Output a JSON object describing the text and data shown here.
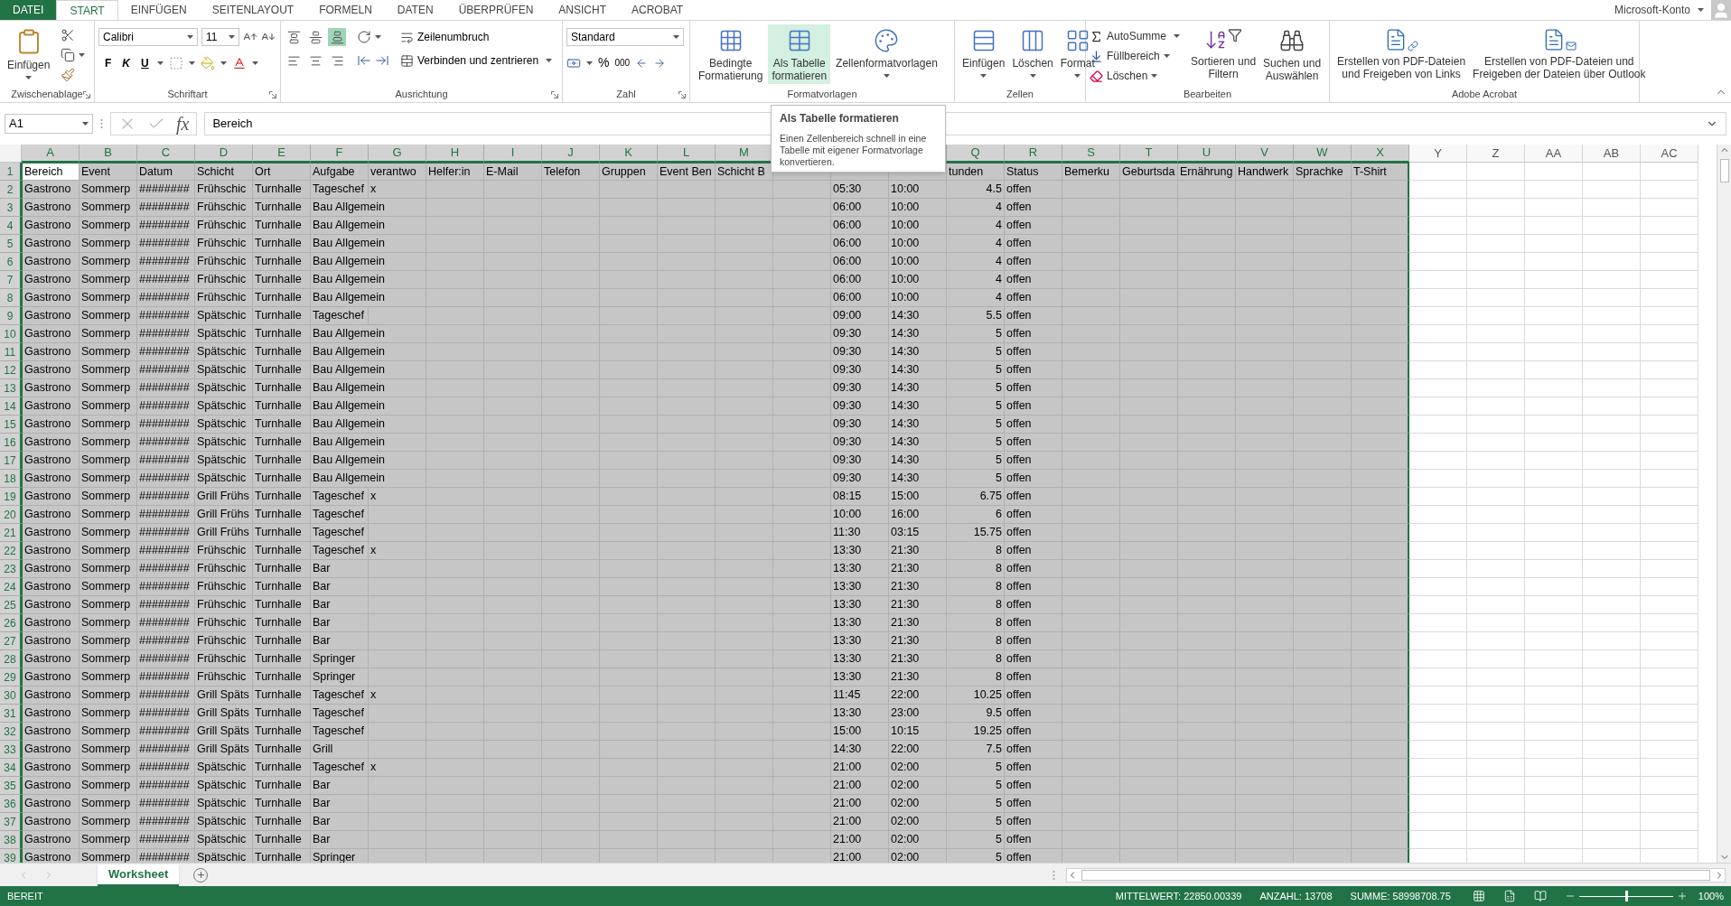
{
  "ribbon": {
    "tabs": [
      {
        "label": "DATEI",
        "kind": "file",
        "selected": false
      },
      {
        "label": "START",
        "kind": "tab",
        "selected": true
      },
      {
        "label": "EINFÜGEN",
        "kind": "tab",
        "selected": false
      },
      {
        "label": "SEITENLAYOUT",
        "kind": "tab",
        "selected": false
      },
      {
        "label": "FORMELN",
        "kind": "tab",
        "selected": false
      },
      {
        "label": "DATEN",
        "kind": "tab",
        "selected": false
      },
      {
        "label": "ÜBERPRÜFEN",
        "kind": "tab",
        "selected": false
      },
      {
        "label": "ANSICHT",
        "kind": "tab",
        "selected": false
      },
      {
        "label": "ACROBAT",
        "kind": "tab",
        "selected": false
      }
    ],
    "account": "Microsoft-Konto",
    "clipboard": {
      "label": "Zwischenablage",
      "paste": "Einfügen"
    },
    "font": {
      "label": "Schriftart",
      "family": "Calibri",
      "size": "11",
      "bold": "F",
      "italic": "K",
      "underline": "U"
    },
    "alignment": {
      "label": "Ausrichtung",
      "align_buttons": [
        {
          "selected": false
        },
        {
          "selected": false
        },
        {
          "selected": true
        },
        {
          "selected": false
        },
        {
          "selected": false
        },
        {
          "selected": false
        }
      ],
      "wrap": "Zeilenumbruch",
      "merge": "Verbinden und zentrieren"
    },
    "number": {
      "label": "Zahl",
      "format": "Standard",
      "percent": "%",
      "thousands": "000"
    },
    "styles": {
      "label": "Formatvorlagen",
      "buttons": [
        {
          "lines": [
            "Bedingte",
            "Formatierung"
          ],
          "hovered": false
        },
        {
          "lines": [
            "Als Tabelle",
            "formatieren"
          ],
          "hovered": true
        },
        {
          "lines": [
            "Zellenformatvorlagen"
          ],
          "hovered": false
        }
      ]
    },
    "cells": {
      "label": "Zellen",
      "buttons": [
        "Einfügen",
        "Löschen",
        "Format"
      ]
    },
    "editing": {
      "label": "Bearbeiten",
      "autosum": "AutoSumme",
      "fill": "Füllbereich",
      "clear": "Löschen",
      "sort": [
        "Sortieren und",
        "Filtern"
      ],
      "find": [
        "Suchen und",
        "Auswählen"
      ]
    },
    "acrobat": {
      "label": "Adobe Acrobat",
      "buttons": [
        [
          "Erstellen von PDF-Dateien",
          "und Freigeben von Links"
        ],
        [
          "Erstellen von PDF-Dateien und",
          "Freigeben der Dateien über Outlook"
        ]
      ]
    }
  },
  "formula_bar": {
    "name_box": "A1",
    "fx": "fx",
    "value": "Bereich"
  },
  "tooltip": {
    "title": "Als Tabelle formatieren",
    "text": "Einen Zellenbereich schnell in eine Tabelle mit eigener Formatvorlage konvertieren."
  },
  "sheet": {
    "columns": [
      {
        "letter": "A",
        "selected": true
      },
      {
        "letter": "B",
        "selected": true
      },
      {
        "letter": "C",
        "selected": true
      },
      {
        "letter": "D",
        "selected": true
      },
      {
        "letter": "E",
        "selected": true
      },
      {
        "letter": "F",
        "selected": true
      },
      {
        "letter": "G",
        "selected": true
      },
      {
        "letter": "H",
        "selected": true
      },
      {
        "letter": "I",
        "selected": true
      },
      {
        "letter": "J",
        "selected": true
      },
      {
        "letter": "K",
        "selected": true
      },
      {
        "letter": "L",
        "selected": true
      },
      {
        "letter": "M",
        "selected": true
      },
      {
        "selected": true
      },
      {
        "selected": true
      },
      {
        "selected": true
      },
      {
        "letter": "Q",
        "selected": true
      },
      {
        "letter": "R",
        "selected": true
      },
      {
        "letter": "S",
        "selected": true
      },
      {
        "letter": "T",
        "selected": true
      },
      {
        "letter": "U",
        "selected": true
      },
      {
        "letter": "V",
        "selected": true
      },
      {
        "letter": "W",
        "selected": true
      },
      {
        "letter": "X",
        "selected": true
      },
      {
        "letter": "Y",
        "selected": false
      },
      {
        "letter": "Z",
        "selected": false
      },
      {
        "letter": "AA",
        "selected": false
      },
      {
        "letter": "AB",
        "selected": false
      },
      {
        "letter": "AC",
        "selected": false
      }
    ],
    "rows": [
      {
        "number": "1",
        "selected": true,
        "cells": {
          "0": "Bereich",
          "1": "Event",
          "2": "Datum",
          "3": "Schicht",
          "4": "Ort",
          "5": "Aufgabe",
          "6": "verantwo",
          "7": "Helfer:in",
          "8": "E-Mail",
          "9": "Telefon",
          "10": "Gruppen",
          "11": "Event Ben",
          "12": "Schicht B",
          "16": "tunden",
          "17": "Status",
          "18": "Bemerku",
          "19": "Geburtsda",
          "20": "Ernährung",
          "21": "Handwerk",
          "22": "Sprachke",
          "23": "T-Shirt"
        }
      },
      {
        "number": "2",
        "selected": true,
        "cells": {
          "0": "Gastrono",
          "1": "Sommerp",
          "2": "########",
          "3": "Frühschic",
          "4": "Turnhalle",
          "5": "Tageschef",
          "6": "x",
          "14": "05:30",
          "15": "10:00",
          "16": "4.5",
          "17": "offen"
        }
      },
      {
        "number": "3",
        "selected": true,
        "cells": {
          "0": "Gastrono",
          "1": "Sommerp",
          "2": "########",
          "3": "Frühschic",
          "4": "Turnhalle",
          "5": "Bau Allgemein",
          "14": "06:00",
          "15": "10:00",
          "16": "4",
          "17": "offen"
        }
      },
      {
        "number": "4",
        "selected": true,
        "cells": {
          "0": "Gastrono",
          "1": "Sommerp",
          "2": "########",
          "3": "Frühschic",
          "4": "Turnhalle",
          "5": "Bau Allgemein",
          "14": "06:00",
          "15": "10:00",
          "16": "4",
          "17": "offen"
        }
      },
      {
        "number": "5",
        "selected": true,
        "cells": {
          "0": "Gastrono",
          "1": "Sommerp",
          "2": "########",
          "3": "Frühschic",
          "4": "Turnhalle",
          "5": "Bau Allgemein",
          "14": "06:00",
          "15": "10:00",
          "16": "4",
          "17": "offen"
        }
      },
      {
        "number": "6",
        "selected": true,
        "cells": {
          "0": "Gastrono",
          "1": "Sommerp",
          "2": "########",
          "3": "Frühschic",
          "4": "Turnhalle",
          "5": "Bau Allgemein",
          "14": "06:00",
          "15": "10:00",
          "16": "4",
          "17": "offen"
        }
      },
      {
        "number": "7",
        "selected": true,
        "cells": {
          "0": "Gastrono",
          "1": "Sommerp",
          "2": "########",
          "3": "Frühschic",
          "4": "Turnhalle",
          "5": "Bau Allgemein",
          "14": "06:00",
          "15": "10:00",
          "16": "4",
          "17": "offen"
        }
      },
      {
        "number": "8",
        "selected": true,
        "cells": {
          "0": "Gastrono",
          "1": "Sommerp",
          "2": "########",
          "3": "Frühschic",
          "4": "Turnhalle",
          "5": "Bau Allgemein",
          "14": "06:00",
          "15": "10:00",
          "16": "4",
          "17": "offen"
        }
      },
      {
        "number": "9",
        "selected": true,
        "cells": {
          "0": "Gastrono",
          "1": "Sommerp",
          "2": "########",
          "3": "Spätschic",
          "4": "Turnhalle",
          "5": "Tageschef",
          "14": "09:00",
          "15": "14:30",
          "16": "5.5",
          "17": "offen"
        }
      },
      {
        "number": "10",
        "selected": true,
        "cells": {
          "0": "Gastrono",
          "1": "Sommerp",
          "2": "########",
          "3": "Spätschic",
          "4": "Turnhalle",
          "5": "Bau Allgemein",
          "14": "09:30",
          "15": "14:30",
          "16": "5",
          "17": "offen"
        }
      },
      {
        "number": "11",
        "selected": true,
        "cells": {
          "0": "Gastrono",
          "1": "Sommerp",
          "2": "########",
          "3": "Spätschic",
          "4": "Turnhalle",
          "5": "Bau Allgemein",
          "14": "09:30",
          "15": "14:30",
          "16": "5",
          "17": "offen"
        }
      },
      {
        "number": "12",
        "selected": true,
        "cells": {
          "0": "Gastrono",
          "1": "Sommerp",
          "2": "########",
          "3": "Spätschic",
          "4": "Turnhalle",
          "5": "Bau Allgemein",
          "14": "09:30",
          "15": "14:30",
          "16": "5",
          "17": "offen"
        }
      },
      {
        "number": "13",
        "selected": true,
        "cells": {
          "0": "Gastrono",
          "1": "Sommerp",
          "2": "########",
          "3": "Spätschic",
          "4": "Turnhalle",
          "5": "Bau Allgemein",
          "14": "09:30",
          "15": "14:30",
          "16": "5",
          "17": "offen"
        }
      },
      {
        "number": "14",
        "selected": true,
        "cells": {
          "0": "Gastrono",
          "1": "Sommerp",
          "2": "########",
          "3": "Spätschic",
          "4": "Turnhalle",
          "5": "Bau Allgemein",
          "14": "09:30",
          "15": "14:30",
          "16": "5",
          "17": "offen"
        }
      },
      {
        "number": "15",
        "selected": true,
        "cells": {
          "0": "Gastrono",
          "1": "Sommerp",
          "2": "########",
          "3": "Spätschic",
          "4": "Turnhalle",
          "5": "Bau Allgemein",
          "14": "09:30",
          "15": "14:30",
          "16": "5",
          "17": "offen"
        }
      },
      {
        "number": "16",
        "selected": true,
        "cells": {
          "0": "Gastrono",
          "1": "Sommerp",
          "2": "########",
          "3": "Spätschic",
          "4": "Turnhalle",
          "5": "Bau Allgemein",
          "14": "09:30",
          "15": "14:30",
          "16": "5",
          "17": "offen"
        }
      },
      {
        "number": "17",
        "selected": true,
        "cells": {
          "0": "Gastrono",
          "1": "Sommerp",
          "2": "########",
          "3": "Spätschic",
          "4": "Turnhalle",
          "5": "Bau Allgemein",
          "14": "09:30",
          "15": "14:30",
          "16": "5",
          "17": "offen"
        }
      },
      {
        "number": "18",
        "selected": true,
        "cells": {
          "0": "Gastrono",
          "1": "Sommerp",
          "2": "########",
          "3": "Spätschic",
          "4": "Turnhalle",
          "5": "Bau Allgemein",
          "14": "09:30",
          "15": "14:30",
          "16": "5",
          "17": "offen"
        }
      },
      {
        "number": "19",
        "selected": true,
        "cells": {
          "0": "Gastrono",
          "1": "Sommerp",
          "2": "########",
          "3": "Grill Frühs",
          "4": "Turnhalle",
          "5": "Tageschef",
          "6": "x",
          "14": "08:15",
          "15": "15:00",
          "16": "6.75",
          "17": "offen"
        }
      },
      {
        "number": "20",
        "selected": true,
        "cells": {
          "0": "Gastrono",
          "1": "Sommerp",
          "2": "########",
          "3": "Grill Frühs",
          "4": "Turnhalle",
          "5": "Tageschef",
          "14": "10:00",
          "15": "16:00",
          "16": "6",
          "17": "offen"
        }
      },
      {
        "number": "21",
        "selected": true,
        "cells": {
          "0": "Gastrono",
          "1": "Sommerp",
          "2": "########",
          "3": "Grill Frühs",
          "4": "Turnhalle",
          "5": "Tageschef",
          "14": "11:30",
          "15": "03:15",
          "16": "15.75",
          "17": "offen"
        }
      },
      {
        "number": "22",
        "selected": true,
        "cells": {
          "0": "Gastrono",
          "1": "Sommerp",
          "2": "########",
          "3": "Frühschic",
          "4": "Turnhalle",
          "5": "Tageschef",
          "6": "x",
          "14": "13:30",
          "15": "21:30",
          "16": "8",
          "17": "offen"
        }
      },
      {
        "number": "23",
        "selected": true,
        "cells": {
          "0": "Gastrono",
          "1": "Sommerp",
          "2": "########",
          "3": "Frühschic",
          "4": "Turnhalle",
          "5": "Bar",
          "14": "13:30",
          "15": "21:30",
          "16": "8",
          "17": "offen"
        }
      },
      {
        "number": "24",
        "selected": true,
        "cells": {
          "0": "Gastrono",
          "1": "Sommerp",
          "2": "########",
          "3": "Frühschic",
          "4": "Turnhalle",
          "5": "Bar",
          "14": "13:30",
          "15": "21:30",
          "16": "8",
          "17": "offen"
        }
      },
      {
        "number": "25",
        "selected": true,
        "cells": {
          "0": "Gastrono",
          "1": "Sommerp",
          "2": "########",
          "3": "Frühschic",
          "4": "Turnhalle",
          "5": "Bar",
          "14": "13:30",
          "15": "21:30",
          "16": "8",
          "17": "offen"
        }
      },
      {
        "number": "26",
        "selected": true,
        "cells": {
          "0": "Gastrono",
          "1": "Sommerp",
          "2": "########",
          "3": "Frühschic",
          "4": "Turnhalle",
          "5": "Bar",
          "14": "13:30",
          "15": "21:30",
          "16": "8",
          "17": "offen"
        }
      },
      {
        "number": "27",
        "selected": true,
        "cells": {
          "0": "Gastrono",
          "1": "Sommerp",
          "2": "########",
          "3": "Frühschic",
          "4": "Turnhalle",
          "5": "Bar",
          "14": "13:30",
          "15": "21:30",
          "16": "8",
          "17": "offen"
        }
      },
      {
        "number": "28",
        "selected": true,
        "cells": {
          "0": "Gastrono",
          "1": "Sommerp",
          "2": "########",
          "3": "Frühschic",
          "4": "Turnhalle",
          "5": "Springer",
          "14": "13:30",
          "15": "21:30",
          "16": "8",
          "17": "offen"
        }
      },
      {
        "number": "29",
        "selected": true,
        "cells": {
          "0": "Gastrono",
          "1": "Sommerp",
          "2": "########",
          "3": "Frühschic",
          "4": "Turnhalle",
          "5": "Springer",
          "14": "13:30",
          "15": "21:30",
          "16": "8",
          "17": "offen"
        }
      },
      {
        "number": "30",
        "selected": true,
        "cells": {
          "0": "Gastrono",
          "1": "Sommerp",
          "2": "########",
          "3": "Grill Späts",
          "4": "Turnhalle",
          "5": "Tageschef",
          "6": "x",
          "14": "11:45",
          "15": "22:00",
          "16": "10.25",
          "17": "offen"
        }
      },
      {
        "number": "31",
        "selected": true,
        "cells": {
          "0": "Gastrono",
          "1": "Sommerp",
          "2": "########",
          "3": "Grill Späts",
          "4": "Turnhalle",
          "5": "Tageschef",
          "14": "13:30",
          "15": "23:00",
          "16": "9.5",
          "17": "offen"
        }
      },
      {
        "number": "32",
        "selected": true,
        "cells": {
          "0": "Gastrono",
          "1": "Sommerp",
          "2": "########",
          "3": "Grill Späts",
          "4": "Turnhalle",
          "5": "Tageschef",
          "14": "15:00",
          "15": "10:15",
          "16": "19.25",
          "17": "offen"
        }
      },
      {
        "number": "33",
        "selected": true,
        "cells": {
          "0": "Gastrono",
          "1": "Sommerp",
          "2": "########",
          "3": "Grill Späts",
          "4": "Turnhalle",
          "5": "Grill",
          "14": "14:30",
          "15": "22:00",
          "16": "7.5",
          "17": "offen"
        }
      },
      {
        "number": "34",
        "selected": true,
        "cells": {
          "0": "Gastrono",
          "1": "Sommerp",
          "2": "########",
          "3": "Spätschic",
          "4": "Turnhalle",
          "5": "Tageschef",
          "6": "x",
          "14": "21:00",
          "15": "02:00",
          "16": "5",
          "17": "offen"
        }
      },
      {
        "number": "35",
        "selected": true,
        "cells": {
          "0": "Gastrono",
          "1": "Sommerp",
          "2": "########",
          "3": "Spätschic",
          "4": "Turnhalle",
          "5": "Bar",
          "14": "21:00",
          "15": "02:00",
          "16": "5",
          "17": "offen"
        }
      },
      {
        "number": "36",
        "selected": true,
        "cells": {
          "0": "Gastrono",
          "1": "Sommerp",
          "2": "########",
          "3": "Spätschic",
          "4": "Turnhalle",
          "5": "Bar",
          "14": "21:00",
          "15": "02:00",
          "16": "5",
          "17": "offen"
        }
      },
      {
        "number": "37",
        "selected": true,
        "cells": {
          "0": "Gastrono",
          "1": "Sommerp",
          "2": "########",
          "3": "Spätschic",
          "4": "Turnhalle",
          "5": "Bar",
          "14": "21:00",
          "15": "02:00",
          "16": "5",
          "17": "offen"
        }
      },
      {
        "number": "38",
        "selected": true,
        "cells": {
          "0": "Gastrono",
          "1": "Sommerp",
          "2": "########",
          "3": "Spätschic",
          "4": "Turnhalle",
          "5": "Bar",
          "14": "21:00",
          "15": "02:00",
          "16": "5",
          "17": "offen"
        }
      },
      {
        "number": "39",
        "selected": true,
        "cells": {
          "0": "Gastrono",
          "1": "Sommerp",
          "2": "########",
          "3": "Spätschic",
          "4": "Turnhalle",
          "5": "Springer",
          "14": "21:00",
          "15": "02:00",
          "16": "5",
          "17": "offen"
        }
      }
    ]
  },
  "sheet_tabs": [
    {
      "label": "Worksheet",
      "selected": true
    }
  ],
  "status_bar": {
    "mode": "BEREIT",
    "average": "MITTELWERT: 22850.00339",
    "count": "ANZAHL: 13708",
    "sum": "SUMME: 58998708.75",
    "zoom": "100%",
    "zoom_slider": {
      "level": 0.5
    }
  }
}
